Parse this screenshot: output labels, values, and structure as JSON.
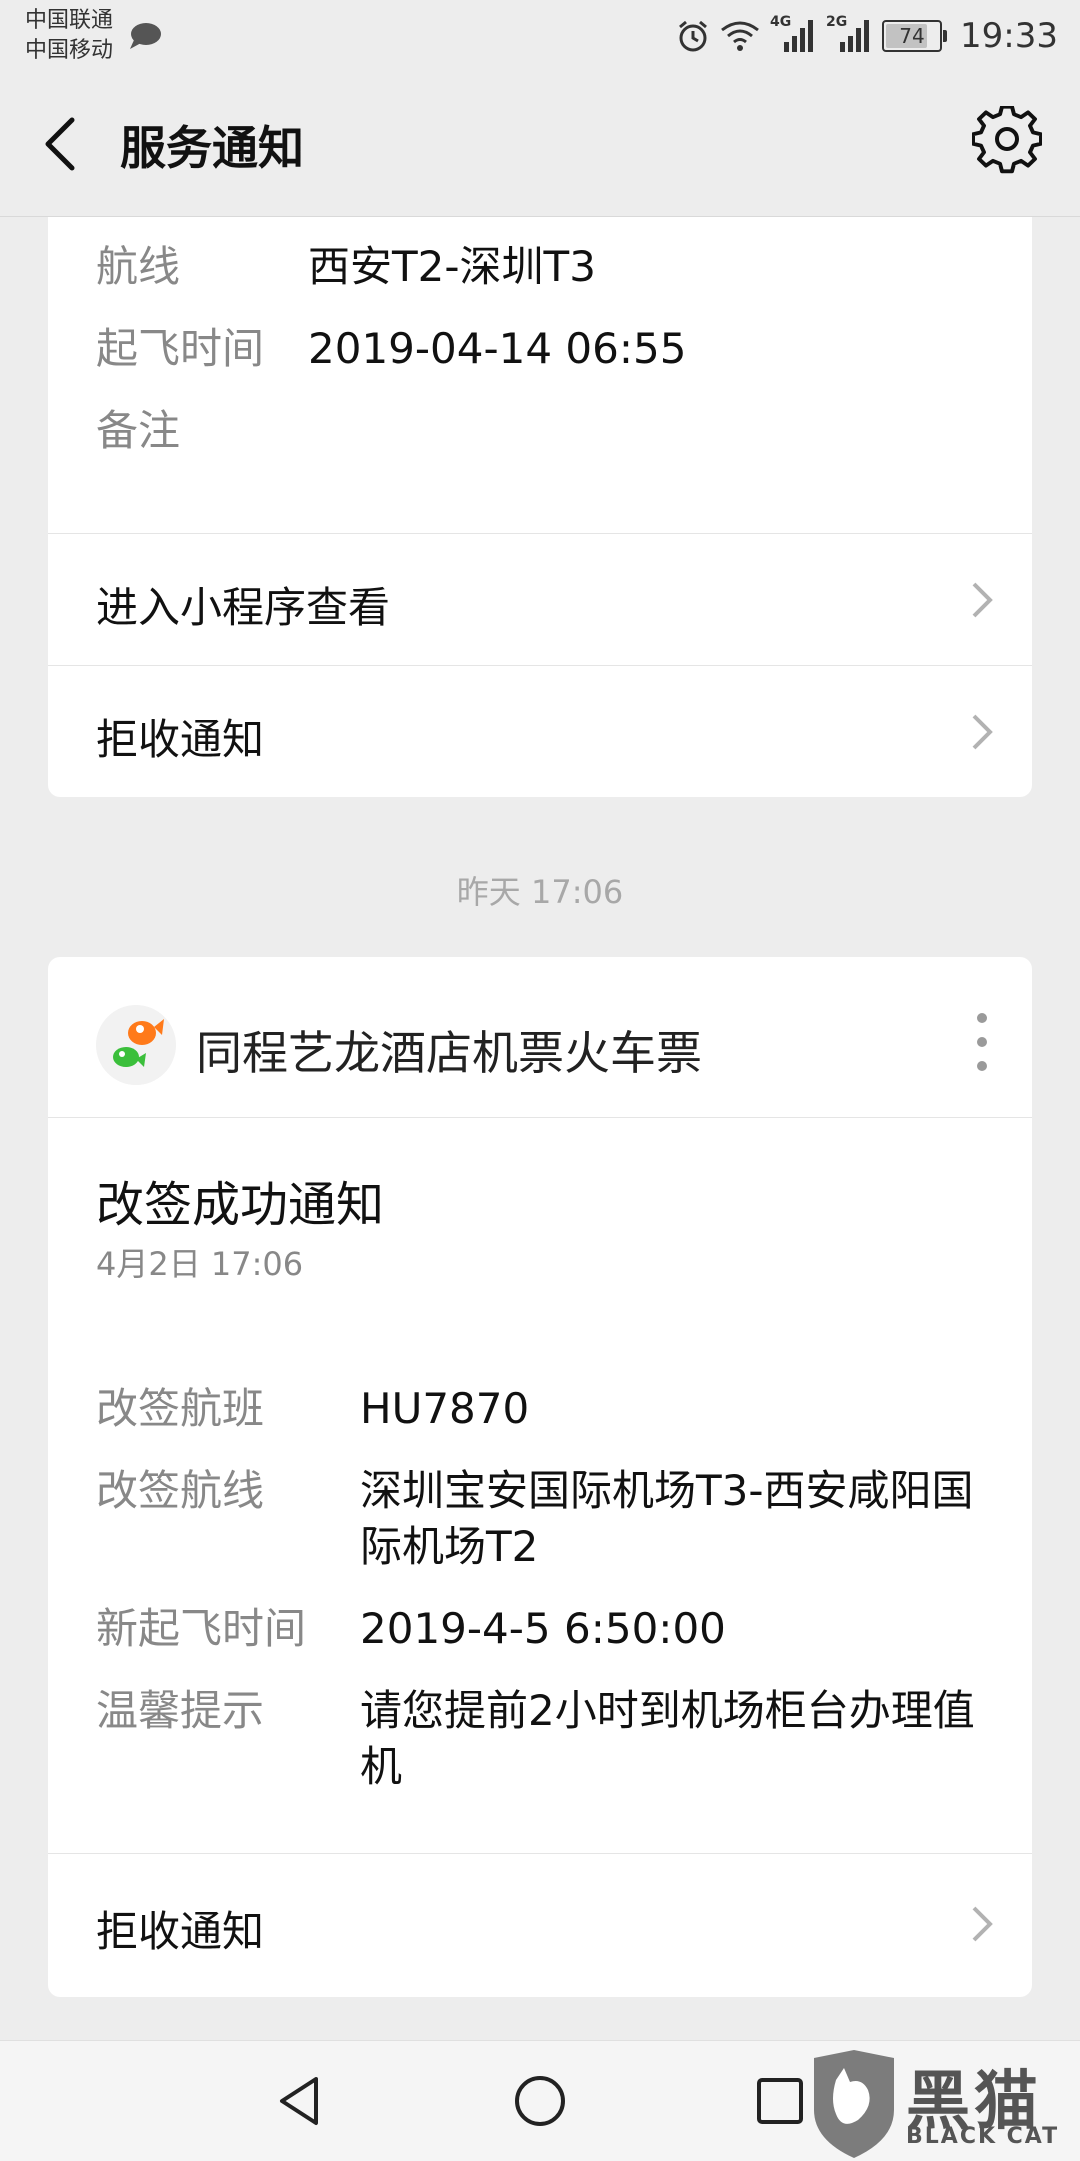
{
  "status_bar": {
    "carrier1": "中国联通",
    "carrier2": "中国移动",
    "network1": "4G",
    "network2": "2G",
    "battery": "74",
    "time": "19:33"
  },
  "nav": {
    "title": "服务通知"
  },
  "card1": {
    "fields": [
      {
        "key": "航线",
        "value": "西安T2-深圳T3"
      },
      {
        "key": "起飞时间",
        "value": "2019-04-14 06:55"
      },
      {
        "key": "备注",
        "value": ""
      }
    ],
    "link_mini_program": "进入小程序查看",
    "link_reject": "拒收通知"
  },
  "separator_time": "昨天 17:06",
  "card2": {
    "account_name": "同程艺龙酒店机票火车票",
    "title": "改签成功通知",
    "date": "4月2日  17:06",
    "fields": [
      {
        "key": "改签航班",
        "value": "HU7870"
      },
      {
        "key": "改签航线",
        "value": "深圳宝安国际机场T3-西安咸阳国际机场T2"
      },
      {
        "key": "新起飞时间",
        "value": "2019-4-5 6:50:00"
      },
      {
        "key": "温馨提示",
        "value": "请您提前2小时到机场柜台办理值机"
      }
    ],
    "link_reject": "拒收通知"
  },
  "watermark": {
    "cn": "黑猫",
    "en": "BLACK CAT"
  },
  "colors": {
    "background": "#ededed",
    "card": "#ffffff",
    "secondary_text": "#888888"
  }
}
